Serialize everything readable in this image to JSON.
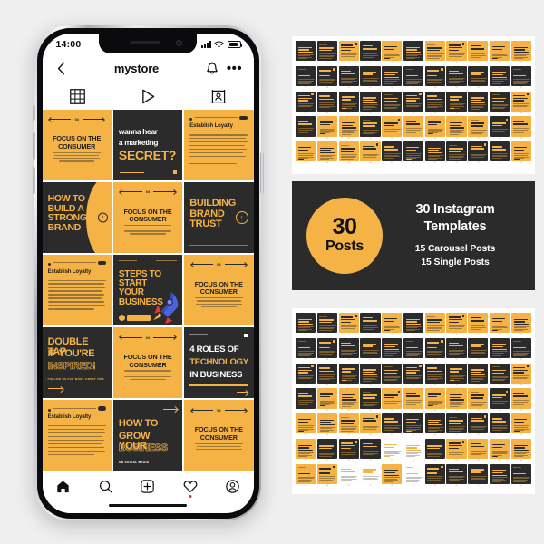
{
  "theme": {
    "yellow": "#f5b346",
    "dark": "#2b2b2b",
    "white": "#ffffff",
    "page_bg": "#efefef"
  },
  "phone": {
    "status": {
      "time": "14:00",
      "signal_icon": "cellular-signal-icon",
      "wifi_icon": "wifi-icon",
      "battery_icon": "battery-icon"
    },
    "header": {
      "back_icon": "back-chevron-icon",
      "title": "mystore",
      "bell_icon": "bell-icon",
      "more_icon": "more-options-icon"
    },
    "tabs": [
      {
        "name": "grid",
        "icon": "grid-icon"
      },
      {
        "name": "reels",
        "icon": "play-triangle-icon"
      },
      {
        "name": "tagged",
        "icon": "tagged-person-icon"
      }
    ],
    "grid": [
      {
        "id": 1,
        "style": "yel",
        "layout": "centered",
        "num": "04",
        "headline": "FOCUS ON THE\nCONSUMER"
      },
      {
        "id": 2,
        "style": "dark",
        "layout": "secret",
        "line1": "wanna hear",
        "line2": "a marketing",
        "line3": "SECRET?"
      },
      {
        "id": 3,
        "style": "yel",
        "layout": "loyalty",
        "headline": "Establish Loyalty"
      },
      {
        "id": 4,
        "style": "dark",
        "layout": "bigleft",
        "headline": "HOW TO\nBUILD A\nSTRONG\nBRAND",
        "chevron": "next-chevron-icon"
      },
      {
        "id": 5,
        "style": "yel",
        "layout": "centered",
        "num": "04",
        "headline": "FOCUS ON THE\nCONSUMER"
      },
      {
        "id": 6,
        "style": "dark",
        "layout": "bigleft",
        "headline": "BUILDING\nBRAND\nTRUST",
        "chevron": "next-chevron-icon"
      },
      {
        "id": 7,
        "style": "yel",
        "layout": "loyalty",
        "headline": "Establish Loyalty"
      },
      {
        "id": 8,
        "style": "dark",
        "layout": "steps",
        "headline": "STEPS TO\nSTART YOUR\nBUSINESS",
        "icon": "rocket-icon"
      },
      {
        "id": 9,
        "style": "yel",
        "layout": "centered",
        "num": "04",
        "headline": "FOCUS ON THE\nCONSUMER"
      },
      {
        "id": 10,
        "style": "dark",
        "layout": "doubletap",
        "line1": "DOUBLE TAP",
        "line2": "IF YOU'RE",
        "line3": "INSPIRED!",
        "footer": "FOLLOW US FOR MORE GREAT TIPS"
      },
      {
        "id": 11,
        "style": "yel",
        "layout": "centered",
        "num": "04",
        "headline": "FOCUS ON THE\nCONSUMER"
      },
      {
        "id": 12,
        "style": "dark",
        "layout": "roles",
        "line1": "4 ROLES OF",
        "line2": "TECHNOLOGY",
        "line3": "IN BUSINESS"
      },
      {
        "id": 13,
        "style": "yel",
        "layout": "loyalty",
        "headline": "Establish Loyalty"
      },
      {
        "id": 14,
        "style": "dark",
        "layout": "grow",
        "line1": "HOW TO",
        "line2": "GROW YOUR",
        "line3": "BUSINESS",
        "footer": "ON SOCIAL MEDIA"
      },
      {
        "id": 15,
        "style": "yel",
        "layout": "centered",
        "num": "04",
        "headline": "FOCUS ON THE\nCONSUMER"
      }
    ],
    "nav": [
      {
        "name": "home",
        "icon": "home-icon"
      },
      {
        "name": "search",
        "icon": "search-icon"
      },
      {
        "name": "create",
        "icon": "plus-square-icon"
      },
      {
        "name": "activity",
        "icon": "heart-icon",
        "badge": true
      },
      {
        "name": "profile",
        "icon": "profile-circle-icon"
      }
    ]
  },
  "banner": {
    "circle_number": "30",
    "circle_label": "Posts",
    "title": "30 Instagram\nTemplates",
    "sub_line1": "15 Carousel Posts",
    "sub_line2": "15 Single Posts"
  },
  "sheets": {
    "top": {
      "columns": 11,
      "rows": 5,
      "cells": [
        "dark",
        "dark",
        "yel",
        "dark",
        "yel",
        "dark",
        "yel",
        "yel",
        "yel",
        "yel",
        "yel",
        "dark",
        "dark",
        "dark",
        "dark",
        "dark",
        "dark",
        "dark",
        "dark",
        "dark",
        "dark",
        "dark",
        "dark",
        "dark",
        "dark",
        "dark",
        "dark",
        "dark",
        "dark",
        "dark",
        "dark",
        "dark",
        "yel",
        "dark",
        "yel",
        "yel",
        "dark",
        "yel",
        "yel",
        "yel",
        "yel",
        "yel",
        "dark",
        "yel",
        "yel",
        "yel",
        "yel",
        "yel",
        "dark",
        "dark",
        "dark",
        "dark",
        "dark",
        "dark",
        "yel"
      ]
    },
    "bottom": {
      "columns": 11,
      "rows": 7,
      "cells": [
        "dark",
        "dark",
        "yel",
        "dark",
        "yel",
        "dark",
        "yel",
        "yel",
        "yel",
        "yel",
        "yel",
        "dark",
        "dark",
        "dark",
        "dark",
        "dark",
        "dark",
        "dark",
        "dark",
        "dark",
        "dark",
        "dark",
        "dark",
        "dark",
        "dark",
        "dark",
        "dark",
        "dark",
        "dark",
        "dark",
        "dark",
        "dark",
        "yel",
        "dark",
        "yel",
        "yel",
        "dark",
        "yel",
        "yel",
        "yel",
        "yel",
        "yel",
        "dark",
        "yel",
        "yel",
        "yel",
        "yel",
        "yel",
        "dark",
        "dark",
        "dark",
        "dark",
        "dark",
        "dark",
        "yel",
        "yel",
        "dark",
        "dark",
        "dark",
        "wht",
        "wht",
        "dark",
        "yel",
        "yel",
        "yel",
        "yel",
        "yel",
        "yel",
        "wht",
        "wht",
        "yel",
        "wht",
        "dark",
        "dark",
        "dark",
        "dark",
        "dark"
      ]
    }
  }
}
